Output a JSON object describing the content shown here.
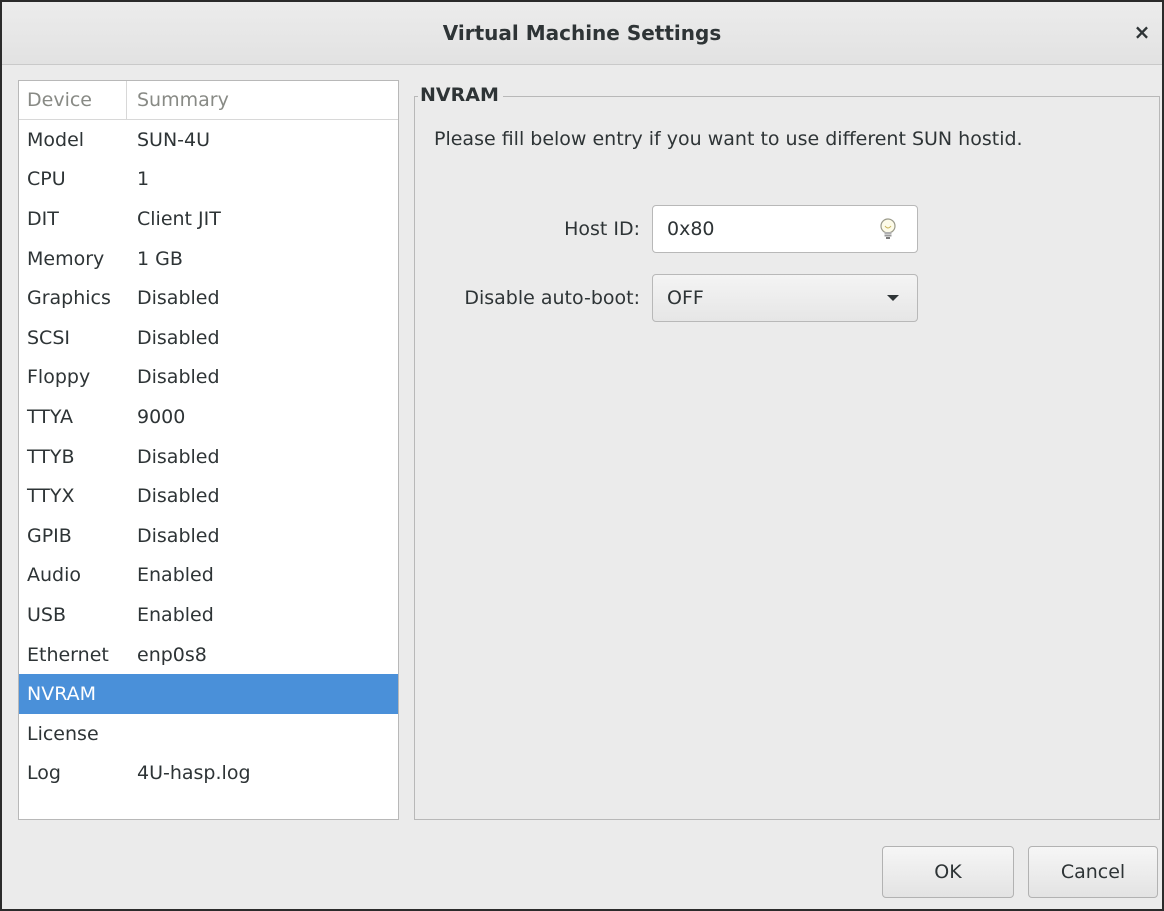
{
  "window": {
    "title": "Virtual Machine Settings",
    "close_glyph": "×"
  },
  "device_list": {
    "headers": {
      "device": "Device",
      "summary": "Summary"
    },
    "rows": [
      {
        "device": "Model",
        "summary": "SUN-4U"
      },
      {
        "device": "CPU",
        "summary": "1"
      },
      {
        "device": "DIT",
        "summary": "Client JIT"
      },
      {
        "device": "Memory",
        "summary": "1 GB"
      },
      {
        "device": "Graphics",
        "summary": "Disabled"
      },
      {
        "device": "SCSI",
        "summary": "Disabled"
      },
      {
        "device": "Floppy",
        "summary": "Disabled"
      },
      {
        "device": "TTYA",
        "summary": "9000"
      },
      {
        "device": "TTYB",
        "summary": "Disabled"
      },
      {
        "device": "TTYX",
        "summary": "Disabled"
      },
      {
        "device": "GPIB",
        "summary": "Disabled"
      },
      {
        "device": "Audio",
        "summary": "Enabled"
      },
      {
        "device": "USB",
        "summary": "Enabled"
      },
      {
        "device": "Ethernet",
        "summary": "enp0s8"
      },
      {
        "device": "NVRAM",
        "summary": ""
      },
      {
        "device": "License",
        "summary": ""
      },
      {
        "device": "Log",
        "summary": "4U-hasp.log"
      }
    ],
    "selected": "NVRAM"
  },
  "nvram": {
    "frame_title": "NVRAM",
    "description": "Please fill below entry if you want to use different SUN hostid.",
    "host_id_label": "Host ID:",
    "host_id_value": "0x80",
    "auto_boot_label": "Disable auto-boot:",
    "auto_boot_value": "OFF"
  },
  "buttons": {
    "ok": "OK",
    "cancel": "Cancel"
  },
  "colors": {
    "selection": "#4a90d9",
    "window_bg": "#ebebeb",
    "text": "#2e3436"
  }
}
